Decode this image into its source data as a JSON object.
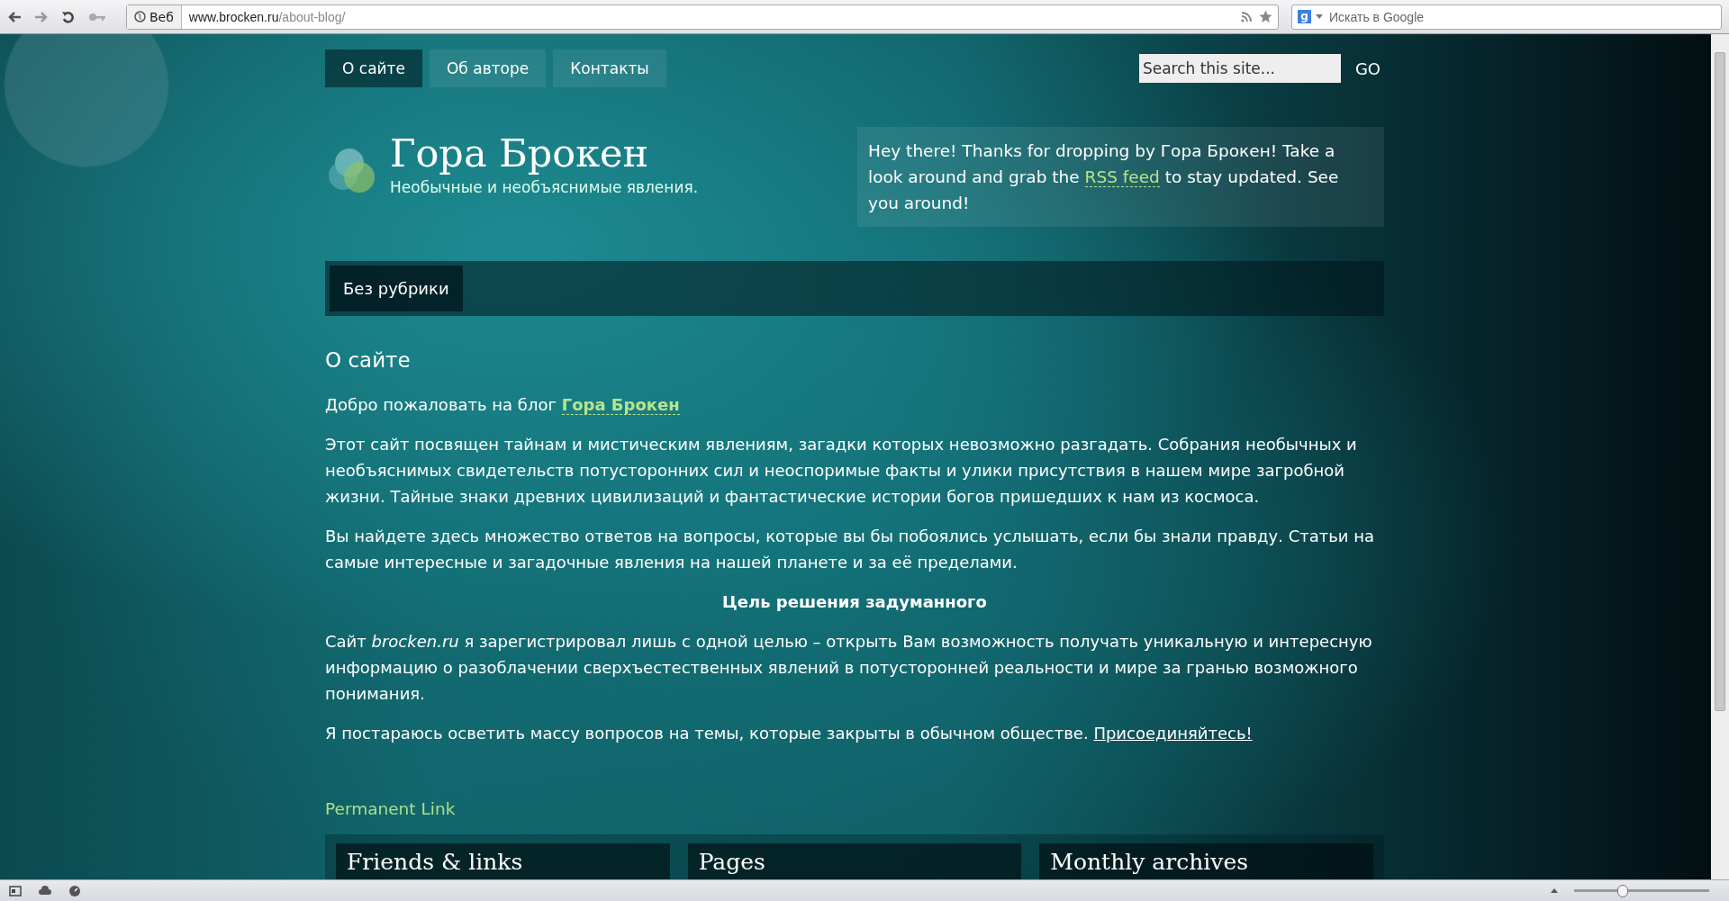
{
  "browser": {
    "identity": "Веб",
    "url_host": "www.brocken.ru",
    "url_path": "/about-blog/",
    "search_placeholder": "Искать в Google",
    "search_engine_letter": "g"
  },
  "nav": [
    {
      "label": "О сайте",
      "selected": true
    },
    {
      "label": "Об авторе",
      "selected": false
    },
    {
      "label": "Контакты",
      "selected": false
    }
  ],
  "site_search": {
    "placeholder": "Search this site...",
    "button": "GO"
  },
  "site": {
    "title": "Гора Брокен",
    "tagline": "Необычные и необъяснимые явления."
  },
  "welcome": {
    "before": "Hey there! Thanks for dropping by Гора Брокен! Take a look around and grab the ",
    "link": "RSS feed",
    "after": " to stay updated. See you around!"
  },
  "categories": [
    {
      "label": "Без рубрики"
    }
  ],
  "post": {
    "title": "О сайте",
    "blocks": [
      {
        "kind": "para",
        "before": "Добро пожаловать на блог ",
        "link": {
          "text": "Гора Брокен",
          "kind": "highlight"
        }
      },
      {
        "kind": "para",
        "before": "Этот сайт посвящен тайнам и мистическим явлениям, загадки которых невозможно разгадать. Собрания необычных и необъяснимых свидетельств потусторонних сил и неоспоримые факты и улики присутствия в нашем мире загробной жизни. Тайные знаки древних цивилизаций и фантастические истории богов пришедших к нам из космоса."
      },
      {
        "kind": "para",
        "before": "Вы найдете здесь множество ответов на вопросы, которые вы бы побоялись услышать, если бы знали правду. Статьи на самые интересные и загадочные явления на нашей планете и за её пределами."
      },
      {
        "kind": "heading",
        "before": "Цель решения задуманного"
      },
      {
        "kind": "para",
        "before": "Сайт *brocken.ru* я зарегистрировал лишь с одной целью – открыть Вам возможность получать уникальную и интересную информацию о разоблачении сверхъестественных явлений в потусторонней реальности и мире за гранью возможного понимания."
      },
      {
        "kind": "para",
        "before": "Я постараюсь осветить массу вопросов на темы, которые закрыты в обычном обществе. ",
        "link": {
          "text": "Присоединяйтесь!",
          "kind": "plain"
        }
      }
    ],
    "permalink": "Permanent Link"
  },
  "widgets": [
    {
      "title": "Friends & links"
    },
    {
      "title": "Pages"
    },
    {
      "title": "Monthly archives"
    }
  ],
  "status_bar": {
    "zoom": {
      "level": 0.36
    }
  }
}
